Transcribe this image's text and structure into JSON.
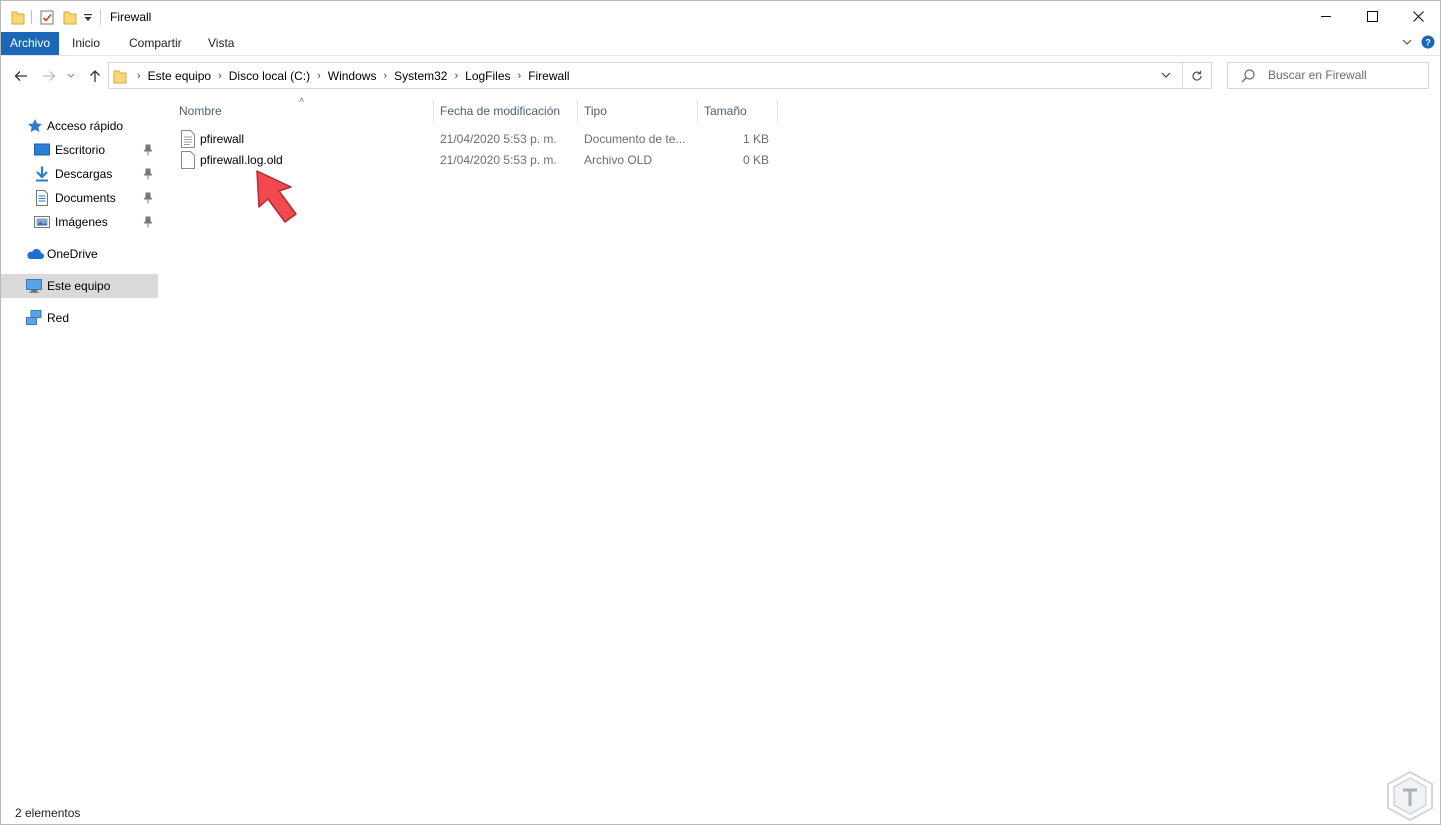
{
  "window": {
    "title": "Firewall",
    "controls": {
      "minimize": "—",
      "maximize": "☐",
      "close": "✕"
    }
  },
  "ribbon": {
    "tabs": [
      "Archivo",
      "Inicio",
      "Compartir",
      "Vista"
    ]
  },
  "address": {
    "crumbs": [
      "Este equipo",
      "Disco local (C:)",
      "Windows",
      "System32",
      "LogFiles",
      "Firewall"
    ]
  },
  "search": {
    "placeholder": "Buscar en Firewall"
  },
  "sidebar": {
    "quick_access": "Acceso rápido",
    "items": [
      {
        "label": "Escritorio",
        "icon": "desktop-icon",
        "pinned": true
      },
      {
        "label": "Descargas",
        "icon": "download-arrow-icon",
        "pinned": true
      },
      {
        "label": "Documents",
        "icon": "document-icon",
        "pinned": true
      },
      {
        "label": "Imágenes",
        "icon": "picture-icon",
        "pinned": true
      }
    ],
    "onedrive": "OneDrive",
    "this_pc": "Este equipo",
    "network": "Red"
  },
  "columns": {
    "name": "Nombre",
    "modified": "Fecha de modificación",
    "type": "Tipo",
    "size": "Tamaño"
  },
  "files": [
    {
      "name": "pfirewall",
      "modified": "21/04/2020 5:53 p. m.",
      "type": "Documento de te...",
      "size": "1 KB"
    },
    {
      "name": "pfirewall.log.old",
      "modified": "21/04/2020 5:53 p. m.",
      "type": "Archivo OLD",
      "size": "0 KB"
    }
  ],
  "status": {
    "count": "2 elementos"
  },
  "colors": {
    "accent": "#1a67b8",
    "annotation_arrow": "#f24850",
    "selected_bg": "#d9d9d9"
  }
}
